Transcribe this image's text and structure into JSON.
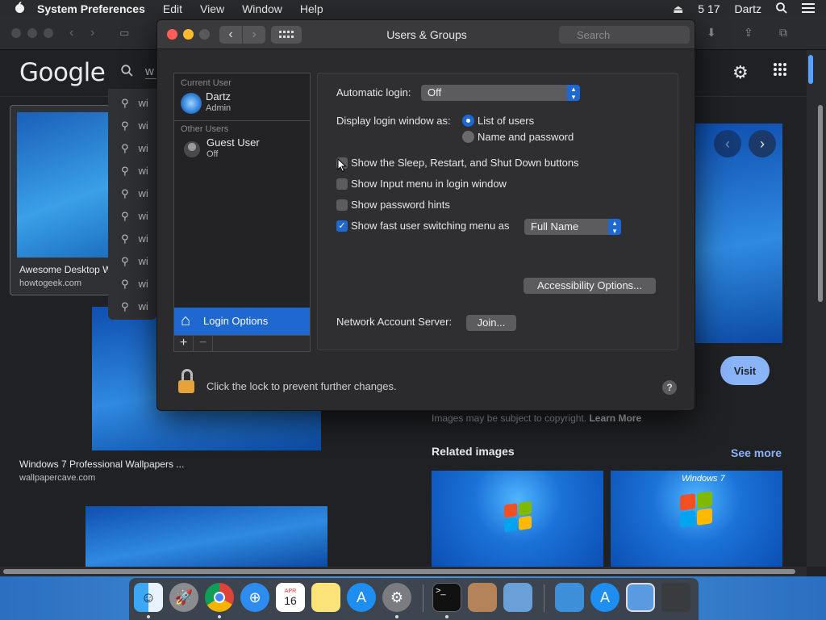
{
  "menubar": {
    "apple": "",
    "app": "System Preferences",
    "items": [
      "Edit",
      "View",
      "Window",
      "Help"
    ],
    "time": "5 17",
    "user": "Dartz"
  },
  "browser": {
    "logo": "Google",
    "query_fragment": "w",
    "suggestion_prefix": "wi",
    "card1": {
      "title": "Awesome Desktop W",
      "domain": "howtogeek.com"
    },
    "card2": {
      "title": "Windows 7 Professional Wallpapers ...",
      "domain": "wallpapercave.com"
    },
    "copyright": "Images may be subject to copyright.",
    "learn_more": "Learn More",
    "visit": "Visit",
    "related": "Related images",
    "see_more": "See more",
    "thumb_text": "Windows 7"
  },
  "window": {
    "title": "Users & Groups",
    "search_placeholder": "Search",
    "sidebar": {
      "current_header": "Current User",
      "current_user": {
        "name": "Dartz",
        "role": "Admin"
      },
      "other_header": "Other Users",
      "guest": {
        "name": "Guest User",
        "status": "Off"
      },
      "login_options": "Login Options",
      "add": "+",
      "remove": "−"
    },
    "panel": {
      "auto_login_label": "Automatic login:",
      "auto_login_value": "Off",
      "display_label": "Display login window as:",
      "radio_list": "List of users",
      "radio_name": "Name and password",
      "cb_sleep": "Show the Sleep, Restart, and Shut Down buttons",
      "cb_input": "Show Input menu in login window",
      "cb_hints": "Show password hints",
      "cb_fast": "Show fast user switching menu as",
      "fast_value": "Full Name",
      "accessibility": "Accessibility Options...",
      "network_label": "Network Account Server:",
      "join": "Join..."
    },
    "lock_message": "Click the lock to prevent further changes.",
    "help": "?"
  },
  "dock": {
    "calendar_month": "APR",
    "calendar_day": "16"
  },
  "colors": {
    "accent": "#1f67d1",
    "link": "#8ab4f8"
  }
}
